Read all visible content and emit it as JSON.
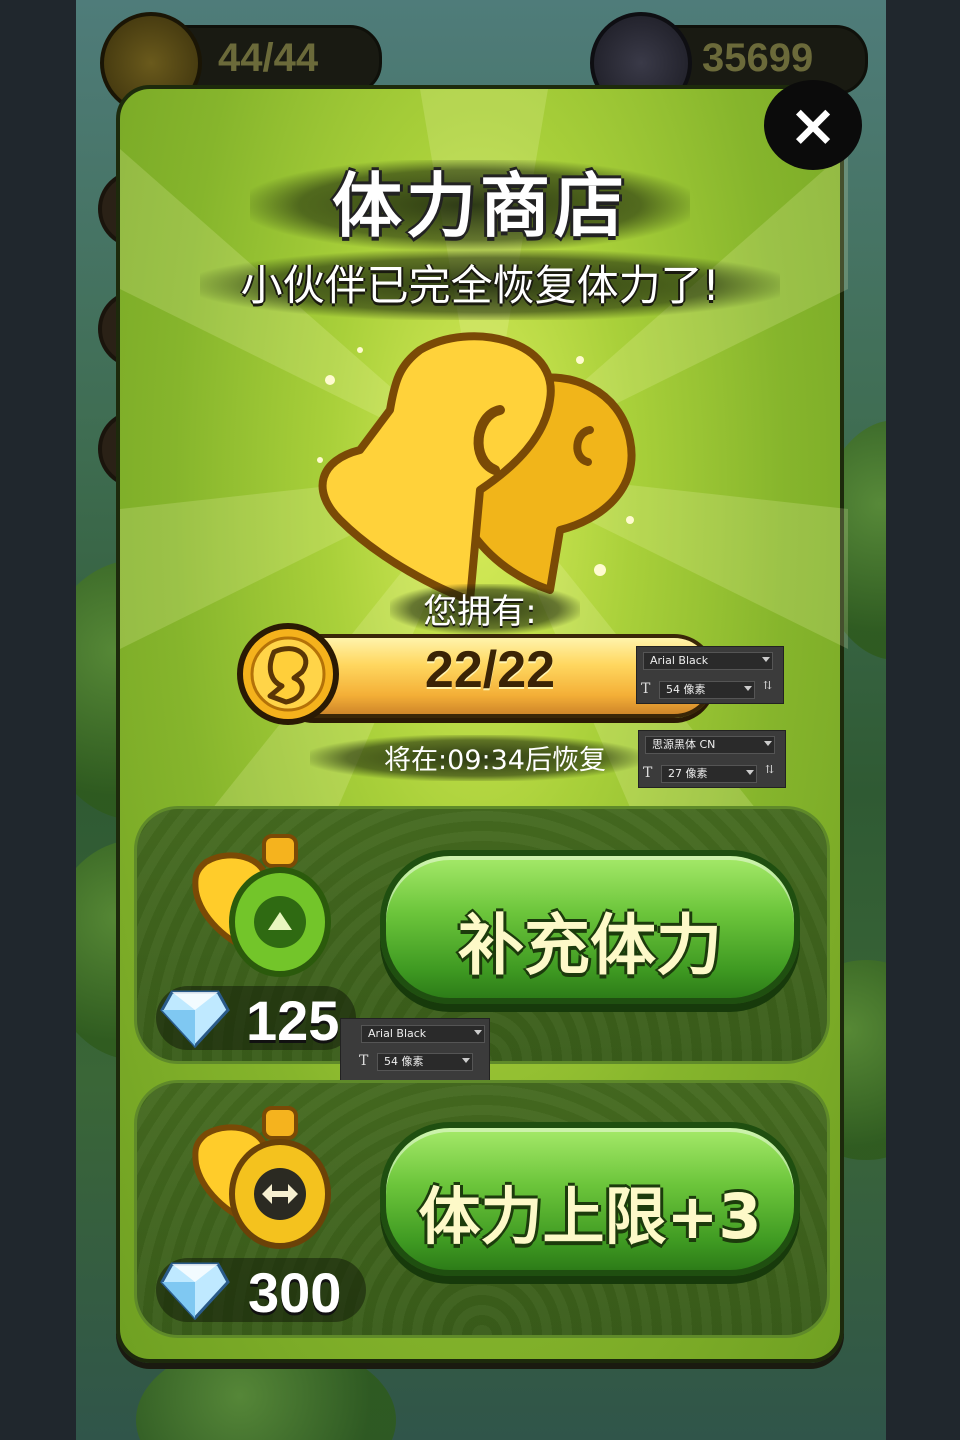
{
  "hud": {
    "stamina": "44/44",
    "diamonds": "35699"
  },
  "shop": {
    "title": "体力商店",
    "subtitle": "小伙伴已完全恢复体力了!",
    "close_icon": "×",
    "owned_label": "您拥有:",
    "stamina_value": "22/22",
    "stamina_progress": 1.0,
    "recover_text": "将在:09:34后恢复"
  },
  "offers": [
    {
      "button_label": "补充体力",
      "price": "125",
      "potion_icon": "green-potion-arrow-up-icon",
      "currency_icon": "diamond-icon"
    },
    {
      "button_label": "体力上限+3",
      "price": "300",
      "potion_icon": "yellow-potion-arrows-icon",
      "currency_icon": "diamond-icon"
    }
  ],
  "font_annotations": [
    {
      "font": "Arial Black",
      "size": "54 像素"
    },
    {
      "font": "思源黑体 CN",
      "size": "27 像素"
    },
    {
      "font": "Arial Black",
      "size": "54 像素"
    }
  ],
  "colors": {
    "panel_green": "#a9d03a",
    "button_green": "#6cc53b",
    "stamina_gold": "#ffd24a"
  }
}
